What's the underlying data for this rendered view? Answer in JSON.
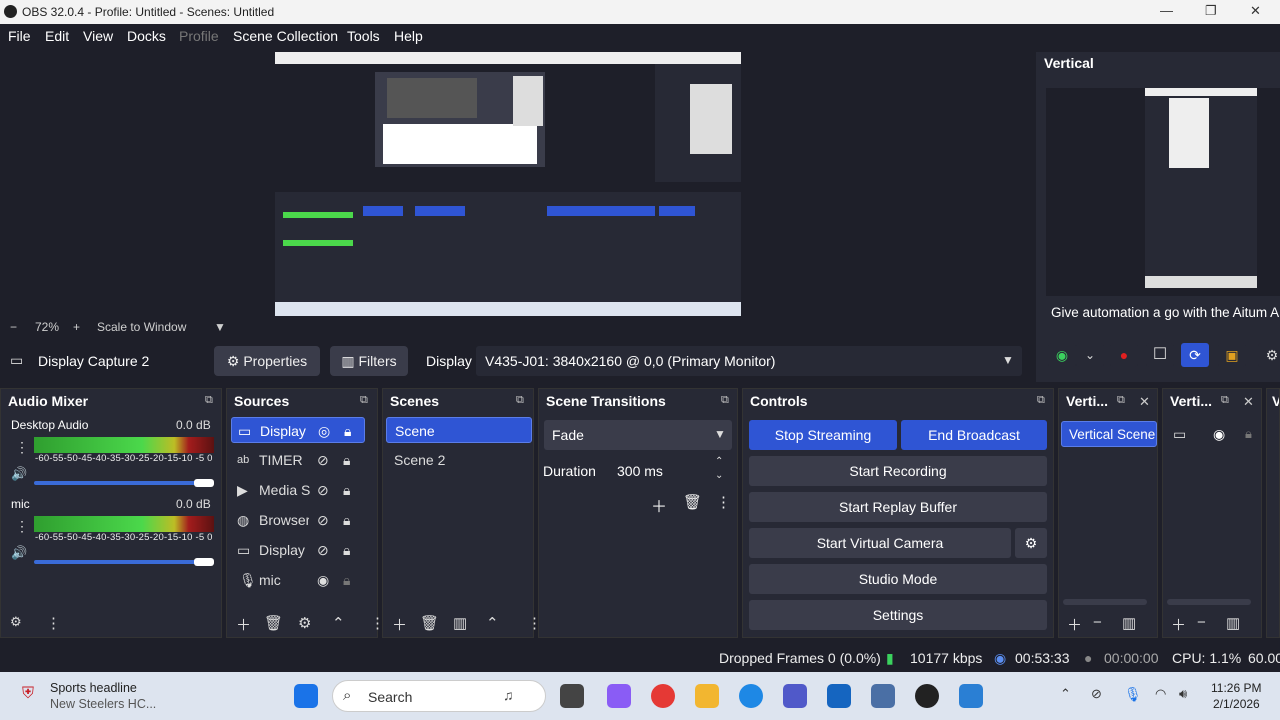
{
  "window": {
    "title": "OBS 32.0.4 - Profile: Untitled - Scenes: Untitled"
  },
  "menu": [
    "File",
    "Edit",
    "View",
    "Docks",
    "Profile",
    "Scene Collection",
    "Tools",
    "Help"
  ],
  "zoom": {
    "level": "72%",
    "mode": "Scale to Window"
  },
  "vertical": {
    "title": "Vertical",
    "text": "Give automation a go with the Aitum A"
  },
  "sourcebar": {
    "name": "Display Capture 2",
    "properties": "Properties",
    "filters": "Filters",
    "display_label": "Display",
    "display_value": "V435-J01: 3840x2160 @ 0,0 (Primary Monitor)"
  },
  "audio": {
    "title": "Audio Mixer",
    "channels": [
      {
        "name": "Desktop Audio",
        "db": "0.0 dB"
      },
      {
        "name": "mic",
        "db": "0.0 dB"
      }
    ],
    "scale": "-60-55-50-45-40-35-30-25-20-15-10 -5 0"
  },
  "sources": {
    "title": "Sources",
    "items": [
      "Display",
      "TIMER",
      "Media S",
      "Browser",
      "Display",
      "mic"
    ]
  },
  "scenes": {
    "title": "Scenes",
    "items": [
      "Scene",
      "Scene 2"
    ]
  },
  "transitions": {
    "title": "Scene Transitions",
    "type": "Fade",
    "duration_label": "Duration",
    "duration": "300 ms"
  },
  "controls": {
    "title": "Controls",
    "stop_streaming": "Stop Streaming",
    "end_broadcast": "End Broadcast",
    "start_recording": "Start Recording",
    "start_replay": "Start Replay Buffer",
    "start_virtual": "Start Virtual Camera",
    "studio_mode": "Studio Mode",
    "settings": "Settings"
  },
  "vdock1": {
    "title": "Verti...",
    "item": "Vertical Scene"
  },
  "vdock2": {
    "title": "Verti..."
  },
  "vdock3": {
    "title": "V"
  },
  "status": {
    "dropped": "Dropped Frames 0 (0.0%)",
    "kbps": "10177 kbps",
    "live": "00:53:33",
    "rec": "00:00:00",
    "cpu": "CPU: 1.1%",
    "fps": "60.00"
  },
  "taskbar": {
    "news_title": "Sports headline",
    "news_sub": "New Steelers HC...",
    "search": "Search",
    "time": "11:26 PM",
    "date": "2/1/2026"
  },
  "colors": {
    "accent": "#2f55d4",
    "panel": "#272935",
    "bg": "#1e1f29"
  }
}
